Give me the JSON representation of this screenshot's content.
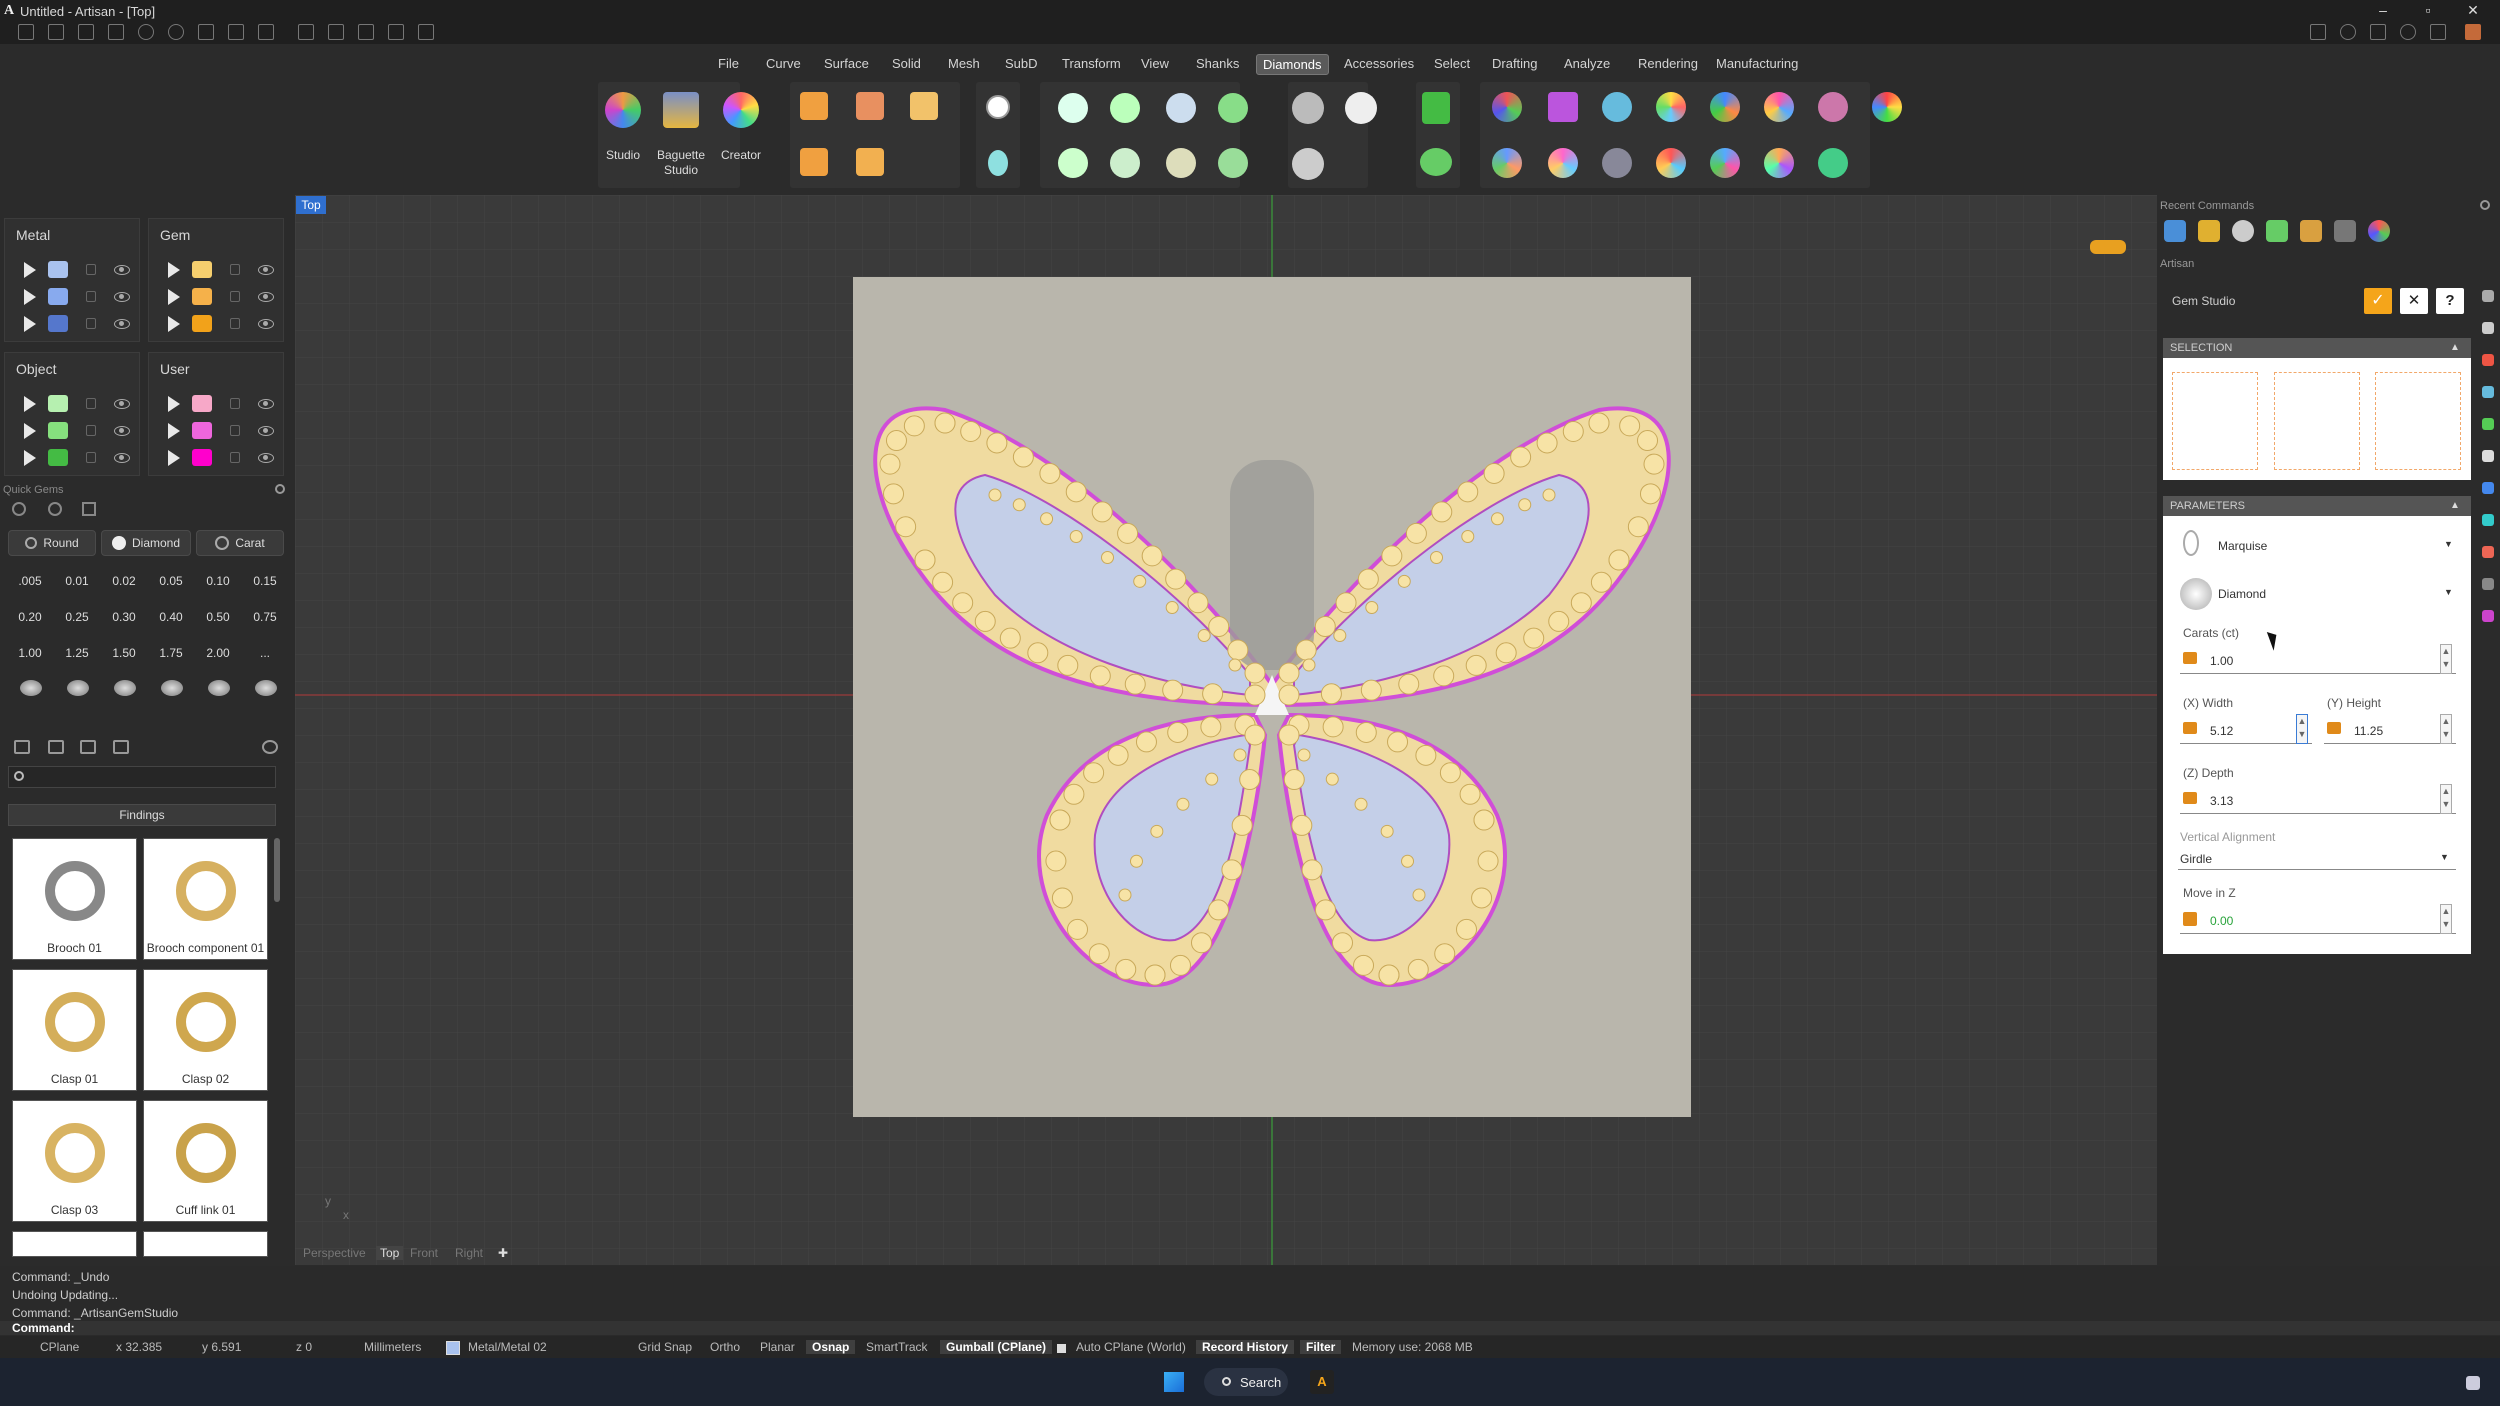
{
  "window": {
    "title": "Untitled - Artisan - [Top]"
  },
  "menu": [
    "File",
    "Curve",
    "Surface",
    "Solid",
    "Mesh",
    "SubD",
    "Transform",
    "View",
    "Shanks",
    "Diamonds",
    "Accessories",
    "Select",
    "Drafting",
    "Analyze",
    "Rendering",
    "Manufacturing"
  ],
  "menu_active": "Diamonds",
  "ribbon": {
    "studio": "Studio",
    "baguette": "Baguette\nStudio",
    "creator": "Creator"
  },
  "layers": {
    "metal": "Metal",
    "gem": "Gem",
    "object": "Object",
    "user": "User",
    "metal_colors": [
      "#a9c2ee",
      "#88aaee",
      "#5577cc"
    ],
    "gem_colors": [
      "#f6cf6e",
      "#f5b14a",
      "#f2a21a"
    ],
    "object_colors": [
      "#b6f0b0",
      "#86e07e",
      "#44bb44"
    ],
    "user_colors": [
      "#f7a8c8",
      "#ee66dd",
      "#ff00cc"
    ]
  },
  "quick_gems": {
    "title": "Quick Gems",
    "chips": [
      "Round",
      "Diamond",
      "Carat"
    ],
    "carats": [
      ".005",
      "0.01",
      "0.02",
      "0.05",
      "0.10",
      "0.15",
      "0.20",
      "0.25",
      "0.30",
      "0.40",
      "0.50",
      "0.75",
      "1.00",
      "1.25",
      "1.50",
      "1.75",
      "2.00",
      "..."
    ]
  },
  "findings": {
    "category": "Findings",
    "items": [
      "Brooch 01",
      "Brooch component 01",
      "Clasp 01",
      "Clasp 02",
      "Clasp 03",
      "Cuff link 01"
    ]
  },
  "viewport": {
    "label": "Top",
    "tabs": [
      "Perspective",
      "Top",
      "Front",
      "Right"
    ],
    "axis_y": "y",
    "axis_x": "x"
  },
  "right_panel": {
    "recent_commands": "Recent Commands",
    "artisan": "Artisan",
    "gem_studio": "Gem Studio",
    "selection": "SELECTION",
    "parameters": "PARAMETERS",
    "shape": "Marquise",
    "material": "Diamond",
    "carats_label": "Carats (ct)",
    "carats": "1.00",
    "width_label": "(X) Width",
    "width": "5.12",
    "height_label": "(Y) Height",
    "height": "11.25",
    "depth_label": "(Z) Depth",
    "depth": "3.13",
    "valign_label": "Vertical Alignment",
    "valign": "Girdle",
    "movez_label": "Move in Z",
    "movez": "0.00"
  },
  "command_history": [
    "Command: _Undo",
    "Undoing Updating...",
    "Command: _ArtisanGemStudio"
  ],
  "command_prompt": "Command:",
  "status": {
    "cplane": "CPlane",
    "x": "x 32.385",
    "y": "y 6.591",
    "z": "z 0",
    "units": "Millimeters",
    "layer": "Metal/Metal 02",
    "grid_snap": "Grid Snap",
    "ortho": "Ortho",
    "planar": "Planar",
    "osnap": "Osnap",
    "smarttrack": "SmartTrack",
    "gumball": "Gumball (CPlane)",
    "auto_cplane": "Auto CPlane (World)",
    "record_history": "Record History",
    "filter": "Filter",
    "memory": "Memory use: 2068 MB"
  },
  "taskbar": {
    "search": "Search"
  }
}
